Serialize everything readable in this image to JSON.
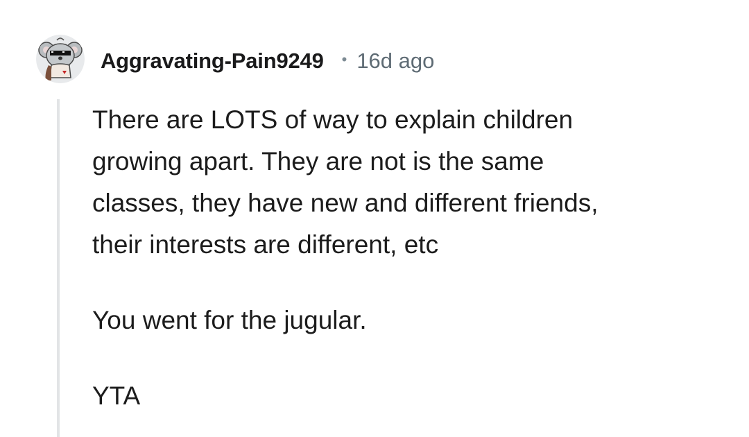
{
  "comment": {
    "author": "Aggravating-Pain9249",
    "separator": "•",
    "timestamp": "16d ago",
    "avatar_icon": "koala-avatar-with-pixel-sunglasses-icon",
    "colors": {
      "username": "#1a1a1b",
      "timestamp": "#5e6b74",
      "body_text": "#1c1c1c",
      "thread_line": "#e2e4e6",
      "avatar_bg": "#e8eaec"
    },
    "paragraphs": [
      "There are LOTS of way to explain children\ngrowing apart. They are not is the same\nclasses, they have new and different friends,\ntheir interests are different, etc",
      "You went for the jugular.",
      "YTA"
    ]
  }
}
